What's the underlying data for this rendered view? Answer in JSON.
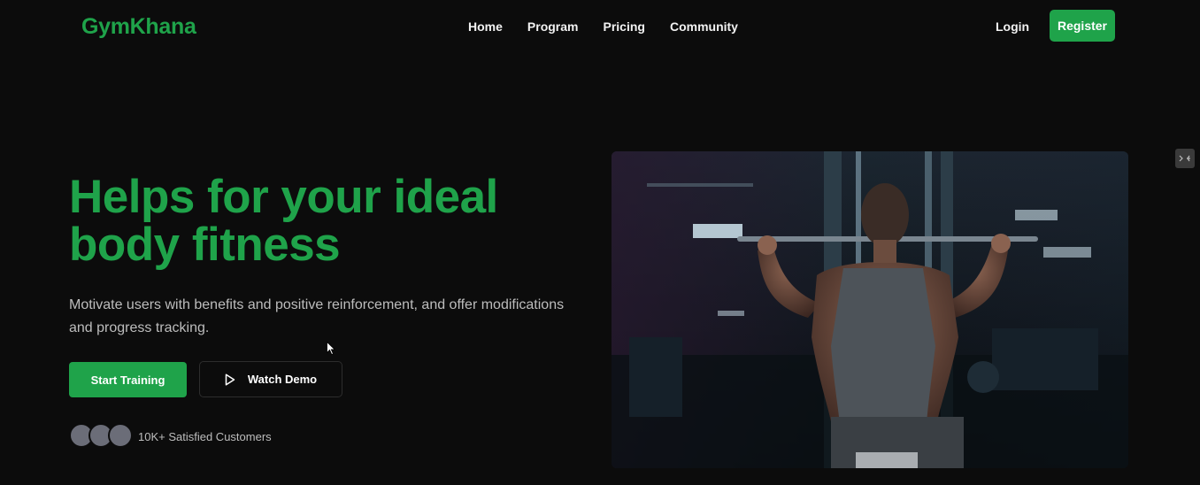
{
  "brand": {
    "logo": "GymKhana",
    "accent": "#1fa34a",
    "background": "#0c0c0c"
  },
  "nav": {
    "links": [
      "Home",
      "Program",
      "Pricing",
      "Community"
    ],
    "login_label": "Login",
    "register_label": "Register"
  },
  "hero": {
    "title_line1": "Helps for your ideal",
    "title_line2": "body fitness",
    "subtitle": "Motivate users with benefits and positive reinforcement, and offer modifications and progress tracking.",
    "primary_button": "Start Training",
    "secondary_button": "Watch Demo",
    "secondary_icon": "play-icon",
    "customers_text": "10K+ Satisfied Customers",
    "image_subject": "man doing lat pulldown in dark gym"
  },
  "icons": {
    "dev_tab": "code-panel-icon",
    "cursor": "mouse-pointer-icon"
  }
}
